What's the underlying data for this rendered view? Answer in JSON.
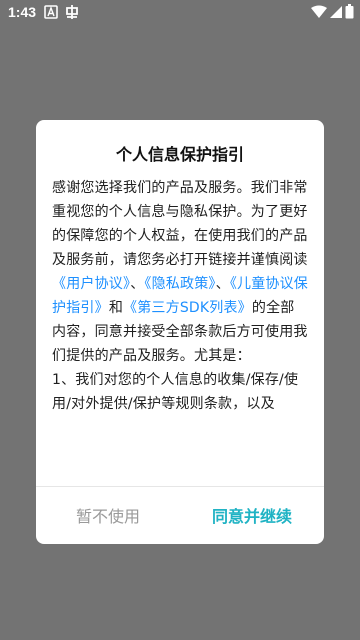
{
  "status_bar": {
    "time": "1:43",
    "icons": [
      "notification-a-icon",
      "app-notification-icon",
      "wifi-icon",
      "signal-icon",
      "battery-icon"
    ]
  },
  "dialog": {
    "title": "个人信息保护指引",
    "body": {
      "intro": "感谢您选择我们的产品及服务。我们非常重视您的个人信息与隐私保护。为了更好的保障您的个人权益，在使用我们的产品及服务前，请您务必打开链接并谨慎阅读",
      "link_user_agreement": "《用户协议》",
      "sep1": "、",
      "link_privacy_policy": "《隐私政策》",
      "sep2": "、",
      "link_child_protection": "《儿童协议保护指引》",
      "and": "和",
      "link_third_party_sdk": "《第三方SDK列表》",
      "outro": "的全部内容，同意并接受全部条款后方可使用我们提供的产品及服务。尤其是：",
      "point1": "1、我们对您的个人信息的收集/保存/使用/对外提供/保护等规则条款，以及"
    },
    "cancel_label": "暂不使用",
    "accept_label": "同意并继续"
  },
  "colors": {
    "backdrop": "#737373",
    "link": "#1e90ff",
    "accept": "#20b3c4",
    "cancel": "#9a9a9a"
  }
}
